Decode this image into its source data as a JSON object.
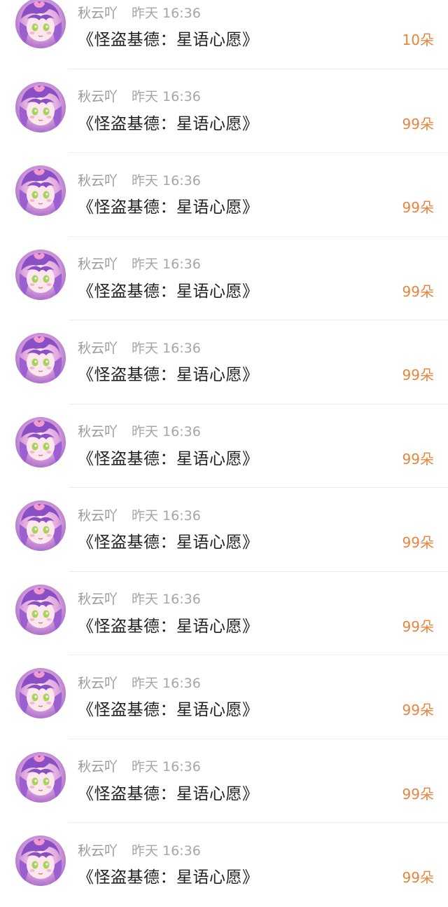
{
  "gift_list": {
    "items": [
      {
        "user": "秋云吖",
        "time": "昨天 16:36",
        "title": "《怪盗基德：星语心愿》",
        "count": "10朵"
      },
      {
        "user": "秋云吖",
        "time": "昨天 16:36",
        "title": "《怪盗基德：星语心愿》",
        "count": "99朵"
      },
      {
        "user": "秋云吖",
        "time": "昨天 16:36",
        "title": "《怪盗基德：星语心愿》",
        "count": "99朵"
      },
      {
        "user": "秋云吖",
        "time": "昨天 16:36",
        "title": "《怪盗基德：星语心愿》",
        "count": "99朵"
      },
      {
        "user": "秋云吖",
        "time": "昨天 16:36",
        "title": "《怪盗基德：星语心愿》",
        "count": "99朵"
      },
      {
        "user": "秋云吖",
        "time": "昨天 16:36",
        "title": "《怪盗基德：星语心愿》",
        "count": "99朵"
      },
      {
        "user": "秋云吖",
        "time": "昨天 16:36",
        "title": "《怪盗基德：星语心愿》",
        "count": "99朵"
      },
      {
        "user": "秋云吖",
        "time": "昨天 16:36",
        "title": "《怪盗基德：星语心愿》",
        "count": "99朵"
      },
      {
        "user": "秋云吖",
        "time": "昨天 16:36",
        "title": "《怪盗基德：星语心愿》",
        "count": "99朵"
      },
      {
        "user": "秋云吖",
        "time": "昨天 16:36",
        "title": "《怪盗基德：星语心愿》",
        "count": "99朵"
      },
      {
        "user": "秋云吖",
        "time": "昨天 16:36",
        "title": "《怪盗基德：星语心愿》",
        "count": "99朵"
      }
    ]
  },
  "colors": {
    "count_accent": "#e8843c",
    "meta_gray": "#9e9e9e",
    "title_text": "#222222"
  },
  "icons": {
    "avatar": "anime-girl-avatar-icon"
  }
}
